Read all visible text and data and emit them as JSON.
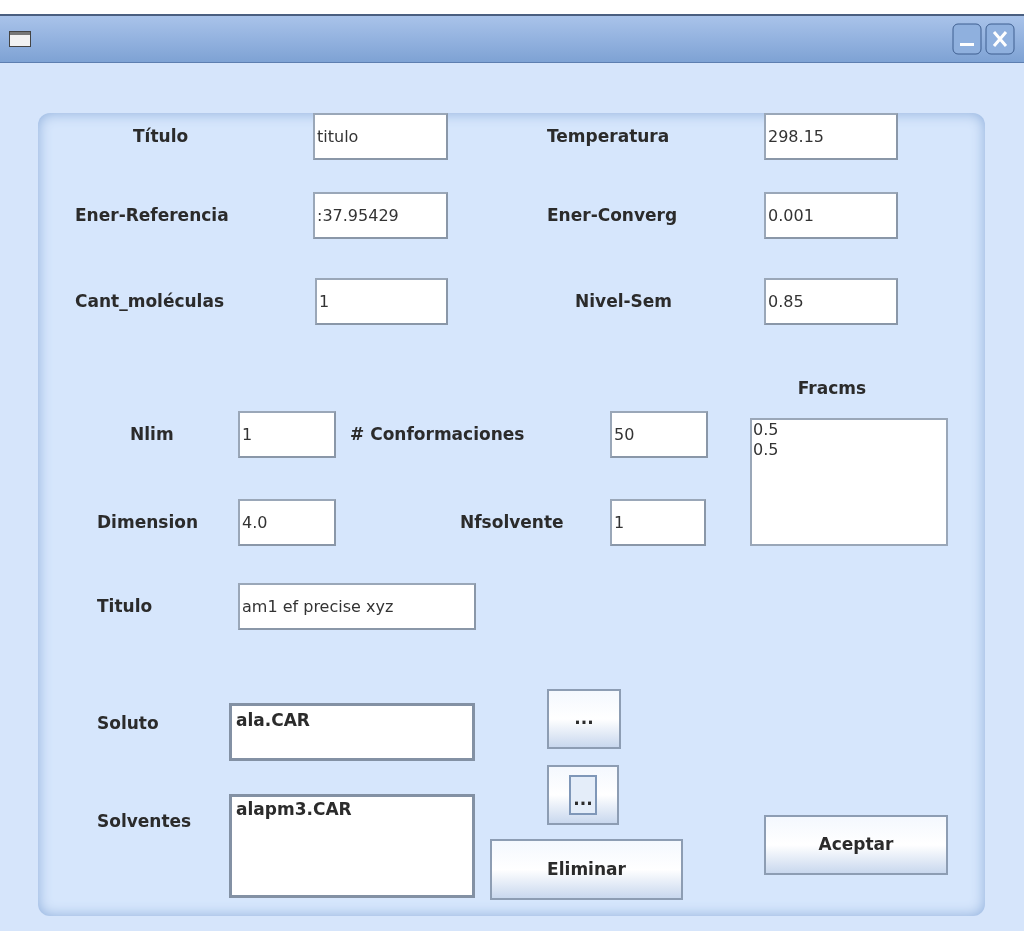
{
  "form": {
    "row_1": [
      {
        "label": "Título",
        "value": "titulo"
      },
      {
        "label": "Temperatura",
        "value": "298.15"
      }
    ],
    "row_2": [
      {
        "label": "Ener-Referencia",
        "value": ":37.95429"
      },
      {
        "label": "Ener-Converg",
        "value": "0.001"
      }
    ],
    "row_3": [
      {
        "label": "Cant_moléculas",
        "value": "1"
      },
      {
        "label": "Nivel-Sem",
        "value": "0.85"
      }
    ],
    "row_4": [
      {
        "label": "Nlim",
        "value": "1"
      },
      {
        "label": "# Conformaciones",
        "value": "50"
      }
    ],
    "row_5": [
      {
        "label": "Dimension",
        "value": "4.0"
      },
      {
        "label": "Nfsolvente",
        "value": "1"
      }
    ],
    "fracms": {
      "label": "Fracms",
      "lines": [
        "0.5",
        "0.5"
      ]
    },
    "titulo": {
      "label": "Titulo",
      "value": "am1 ef precise xyz"
    },
    "soluto": {
      "label": "Soluto",
      "lines": [
        "ala.CAR"
      ]
    },
    "solventes": {
      "label": "Solventes",
      "lines": [
        "alapm3.CAR"
      ]
    }
  },
  "buttons": [
    {
      "label": "...",
      "focused": false
    },
    {
      "label": "...",
      "focused": true
    },
    {
      "label": "Eliminar",
      "focused": false
    },
    {
      "label": "Aceptar",
      "focused": false
    }
  ]
}
